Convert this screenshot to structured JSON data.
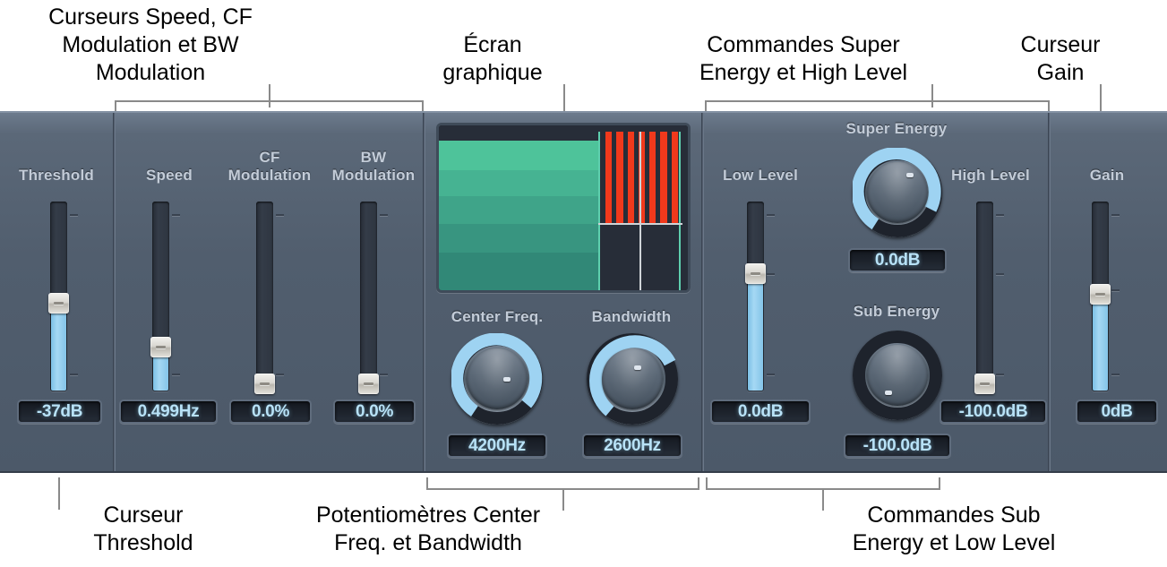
{
  "annotations": {
    "top_left": "Curseurs Speed, CF\nModulation et BW\nModulation",
    "top_center": "Écran\ngraphique",
    "top_right": "Commandes Super\nEnergy et High Level",
    "top_far_right": "Curseur\nGain",
    "bottom_left": "Curseur\nThreshold",
    "bottom_center": "Potentiomètres Center\nFreq. et Bandwidth",
    "bottom_right": "Commandes Sub\nEnergy et Low Level"
  },
  "plugin": {
    "controls": {
      "threshold": {
        "label": "Threshold",
        "value": "-37dB",
        "fill_pct": 46,
        "thumb_pct": 46
      },
      "speed": {
        "label": "Speed",
        "value": "0.499Hz",
        "fill_pct": 23,
        "thumb_pct": 23
      },
      "cf_modulation": {
        "label": "CF\nModulation",
        "value": "0.0%",
        "fill_pct": 0,
        "thumb_pct": 2
      },
      "bw_modulation": {
        "label": "BW\nModulation",
        "value": "0.0%",
        "fill_pct": 0,
        "thumb_pct": 2
      },
      "center_freq": {
        "label": "Center Freq.",
        "value": "4200Hz",
        "arc_pct": 68
      },
      "bandwidth": {
        "label": "Bandwidth",
        "value": "2600Hz",
        "arc_pct": 55
      },
      "low_level": {
        "label": "Low Level",
        "value": "0.0dB",
        "fill_pct": 62,
        "thumb_pct": 62
      },
      "super_energy": {
        "label": "Super Energy",
        "value": "0.0dB",
        "arc_pct": 62
      },
      "sub_energy": {
        "label": "Sub Energy",
        "value": "-100.0dB",
        "arc_pct": 0
      },
      "high_level": {
        "label": "High Level",
        "value": "-100.0dB",
        "fill_pct": 0,
        "thumb_pct": 2
      },
      "gain": {
        "label": "Gain",
        "value": "0dB",
        "fill_pct": 51,
        "thumb_pct": 51
      }
    },
    "graphic_display": {
      "name": "graphic-display",
      "green_bands": [
        {
          "top_pct": 9,
          "height_pct": 18,
          "color": "#4ec39a"
        },
        {
          "top_pct": 27,
          "height_pct": 16,
          "color": "#46b392"
        },
        {
          "top_pct": 43,
          "height_pct": 17,
          "color": "#3fa489"
        },
        {
          "top_pct": 60,
          "height_pct": 17,
          "color": "#389580"
        },
        {
          "top_pct": 77,
          "height_pct": 23,
          "color": "#318877"
        }
      ],
      "green_width_pct": 64,
      "red_bars": 7,
      "red_bar_color": "#f1391c",
      "marker_color": "#5ecfae",
      "crosshair_color": "#cfd4d8"
    },
    "colors": {
      "panel_bg": "#515e6e",
      "label_text": "#c3ccd8",
      "value_text": "#b8e2f7",
      "slider_fill": "#a5d8f4",
      "knob_arc": "#9ed3f2",
      "red_bars": "#f1391c",
      "green_bands": "#4ec39a"
    }
  }
}
